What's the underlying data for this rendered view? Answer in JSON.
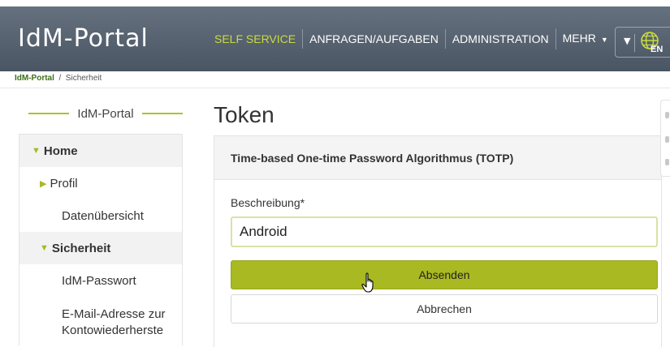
{
  "header": {
    "logo": "IdM-Portal",
    "nav": [
      {
        "label": "SELF SERVICE"
      },
      {
        "label": "ANFRAGEN/AUFGABEN"
      },
      {
        "label": "ADMINISTRATION"
      },
      {
        "label": "MEHR"
      }
    ],
    "lang_label": "EN"
  },
  "breadcrumb": {
    "home": "IdM-Portal",
    "sep": "/",
    "current": "Sicherheit"
  },
  "sidebar": {
    "title": "IdM-Portal",
    "items": [
      {
        "label": "Home"
      },
      {
        "label": "Profil"
      },
      {
        "label": "Datenübersicht"
      },
      {
        "label": "Sicherheit"
      },
      {
        "label": "IdM-Passwort"
      },
      {
        "label": "E-Mail-Adresse zur Kontowiederherste"
      }
    ]
  },
  "main": {
    "title": "Token",
    "panel_title": "Time-based One-time Password Algorithmus (TOTP)",
    "field_label": "Beschreibung*",
    "field_value": "Android",
    "submit_label": "Absenden",
    "cancel_label": "Abbrechen"
  },
  "colors": {
    "accent": "#a9b922",
    "active_nav": "#c9dc3c",
    "header": "#5b6572"
  }
}
